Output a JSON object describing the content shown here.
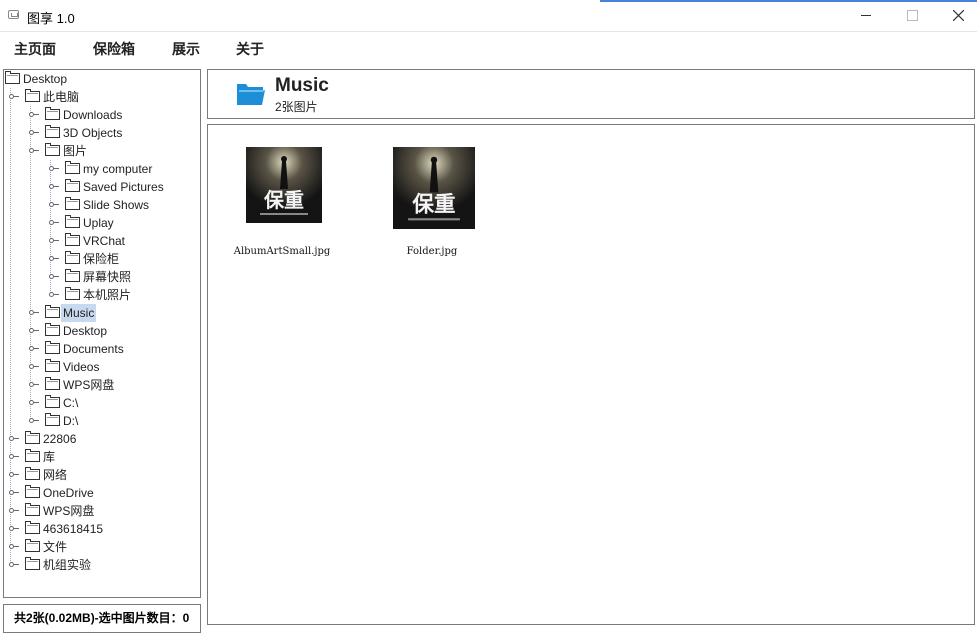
{
  "window": {
    "title": "图享 1.0"
  },
  "menu": {
    "items": [
      "主页面",
      "保险箱",
      "展示",
      "关于"
    ]
  },
  "tree": [
    {
      "label": "Desktop",
      "level": 0,
      "handle": false,
      "selected": false
    },
    {
      "label": "此电脑",
      "level": 1,
      "handle": true,
      "selected": false
    },
    {
      "label": "Downloads",
      "level": 2,
      "handle": true,
      "selected": false
    },
    {
      "label": "3D Objects",
      "level": 2,
      "handle": true,
      "selected": false
    },
    {
      "label": "图片",
      "level": 2,
      "handle": true,
      "selected": false
    },
    {
      "label": "my computer",
      "level": 3,
      "handle": true,
      "selected": false
    },
    {
      "label": "Saved Pictures",
      "level": 3,
      "handle": true,
      "selected": false
    },
    {
      "label": "Slide Shows",
      "level": 3,
      "handle": true,
      "selected": false
    },
    {
      "label": "Uplay",
      "level": 3,
      "handle": true,
      "selected": false
    },
    {
      "label": "VRChat",
      "level": 3,
      "handle": true,
      "selected": false
    },
    {
      "label": "保险柜",
      "level": 3,
      "handle": true,
      "selected": false
    },
    {
      "label": "屏幕快照",
      "level": 3,
      "handle": true,
      "selected": false
    },
    {
      "label": "本机照片",
      "level": 3,
      "handle": true,
      "selected": false
    },
    {
      "label": "Music",
      "level": 2,
      "handle": true,
      "selected": true
    },
    {
      "label": "Desktop",
      "level": 2,
      "handle": true,
      "selected": false
    },
    {
      "label": "Documents",
      "level": 2,
      "handle": true,
      "selected": false
    },
    {
      "label": "Videos",
      "level": 2,
      "handle": true,
      "selected": false
    },
    {
      "label": "WPS网盘",
      "level": 2,
      "handle": true,
      "selected": false
    },
    {
      "label": "C:\\",
      "level": 2,
      "handle": true,
      "selected": false
    },
    {
      "label": "D:\\",
      "level": 2,
      "handle": true,
      "selected": false
    },
    {
      "label": "22806",
      "level": 1,
      "handle": true,
      "selected": false
    },
    {
      "label": "库",
      "level": 1,
      "handle": true,
      "selected": false
    },
    {
      "label": "网络",
      "level": 1,
      "handle": true,
      "selected": false
    },
    {
      "label": "OneDrive",
      "level": 1,
      "handle": true,
      "selected": false
    },
    {
      "label": "WPS网盘",
      "level": 1,
      "handle": true,
      "selected": false
    },
    {
      "label": "463618415",
      "level": 1,
      "handle": true,
      "selected": false
    },
    {
      "label": "文件",
      "level": 1,
      "handle": true,
      "selected": false
    },
    {
      "label": "机组实验",
      "level": 1,
      "handle": true,
      "selected": false
    }
  ],
  "status": {
    "text": "共2张(0.02MB)-选中图片数目：0"
  },
  "header": {
    "folder_name": "Music",
    "count_text": "2张图片",
    "folder_icon": "folder-open-icon",
    "folder_color": "#1e8fd6"
  },
  "images": [
    {
      "filename": "AlbumArtSmall.jpg",
      "art_text": "保重"
    },
    {
      "filename": "Folder.jpg",
      "art_text": "保重"
    }
  ]
}
